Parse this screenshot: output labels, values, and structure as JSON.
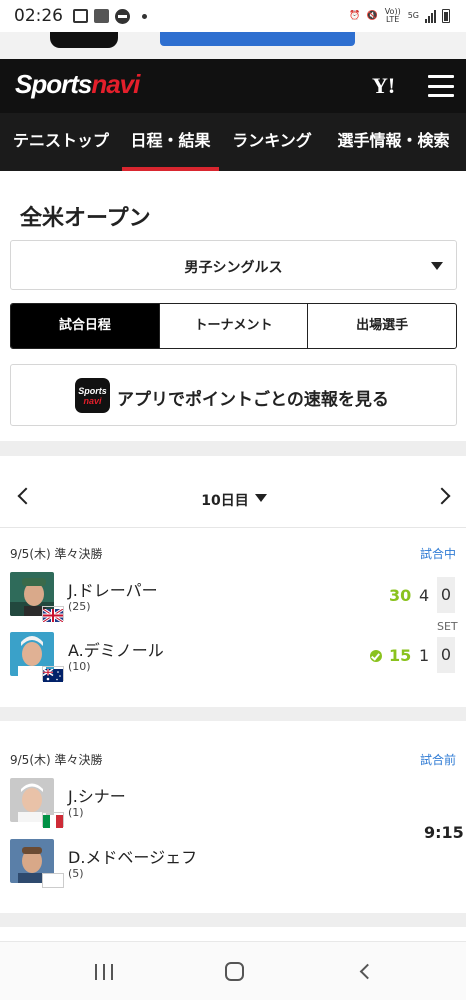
{
  "status_bar": {
    "time": "02:26",
    "volte_label": "Vo)) LTE",
    "network_label": "5G"
  },
  "header": {
    "logo_part1": "Sports",
    "logo_part2": "navi",
    "yahoo_logo": "Y!",
    "menu_icon": "hamburger-menu-icon"
  },
  "nav_tabs": [
    {
      "label": "テニストップ",
      "active": false
    },
    {
      "label": "日程・結果",
      "active": true
    },
    {
      "label": "ランキング",
      "active": false
    },
    {
      "label": "選手情報・検索",
      "active": false
    }
  ],
  "page_title": "全米オープン",
  "event_select": {
    "value": "男子シングルス"
  },
  "segments": [
    {
      "label": "試合日程",
      "active": true
    },
    {
      "label": "トーナメント",
      "active": false
    },
    {
      "label": "出場選手",
      "active": false
    }
  ],
  "app_banner": {
    "icon_line1": "Sports",
    "icon_line2": "navi",
    "text": "アプリでポイントごとの速報を見る"
  },
  "day_nav": {
    "label": "10日目"
  },
  "matches": [
    {
      "header": "9/5(木) 準々決勝",
      "status": "試合中",
      "set_label": "SET",
      "players": [
        {
          "name": "J.ドレーパー",
          "seed": "(25)",
          "game_score": "30",
          "sets_won": "4",
          "current_set": "0",
          "serving": false
        },
        {
          "name": "A.デミノール",
          "seed": "(10)",
          "game_score": "15",
          "sets_won": "1",
          "current_set": "0",
          "serving": true
        }
      ]
    },
    {
      "header": "9/5(木) 準々決勝",
      "status": "試合前",
      "time": "9:15",
      "players": [
        {
          "name": "J.シナー",
          "seed": "(1)"
        },
        {
          "name": "D.メドベージェフ",
          "seed": "(5)"
        }
      ]
    }
  ],
  "colors": {
    "header_bg": "#111111",
    "accent_red": "#d9262f",
    "link_blue": "#2f7bd4",
    "score_green": "#8ac21e"
  }
}
